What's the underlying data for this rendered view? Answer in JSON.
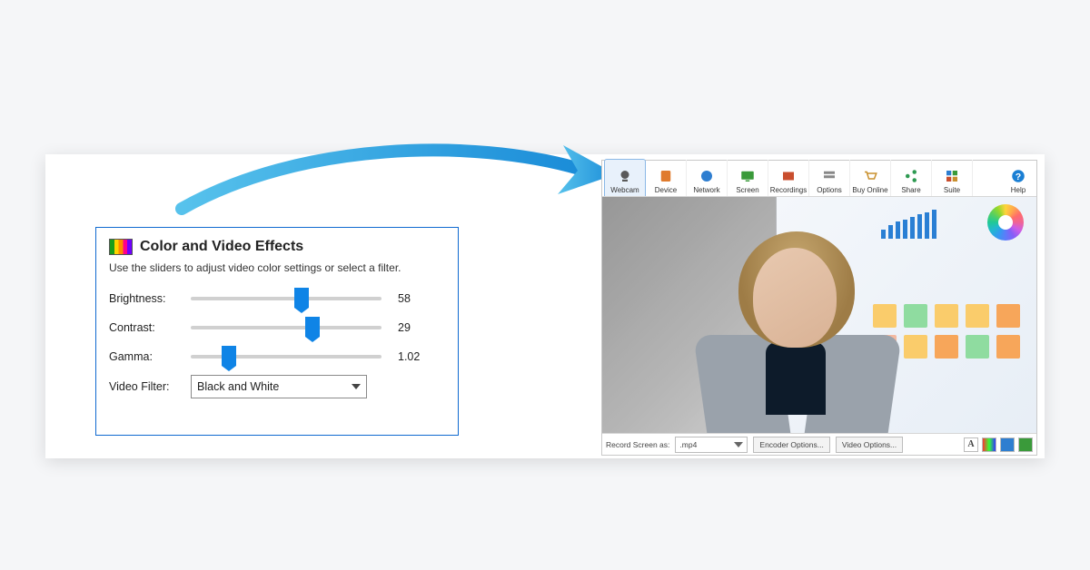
{
  "panel": {
    "title": "Color and Video Effects",
    "description": "Use the sliders to adjust video color settings or select a filter.",
    "brightness": {
      "label": "Brightness:",
      "value": "58",
      "pct": 58
    },
    "contrast": {
      "label": "Contrast:",
      "value": "29",
      "pct": 64
    },
    "gamma": {
      "label": "Gamma:",
      "value": "1.02",
      "pct": 20
    },
    "filter": {
      "label": "Video Filter:",
      "selected": "Black and White"
    }
  },
  "toolbar": {
    "items": [
      {
        "label": "Webcam"
      },
      {
        "label": "Device"
      },
      {
        "label": "Network"
      },
      {
        "label": "Screen"
      },
      {
        "label": "Recordings"
      },
      {
        "label": "Options"
      },
      {
        "label": "Buy Online"
      },
      {
        "label": "Share"
      },
      {
        "label": "Suite"
      }
    ],
    "help": "Help"
  },
  "statusbar": {
    "record_label": "Record Screen as:",
    "format": ".mp4",
    "encoder_btn": "Encoder Options...",
    "video_btn": "Video Options..."
  }
}
